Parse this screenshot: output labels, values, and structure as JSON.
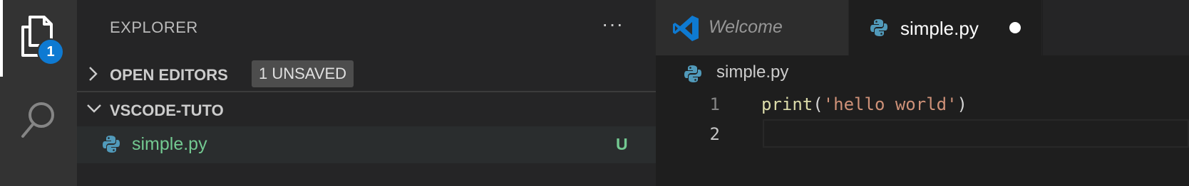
{
  "activity": {
    "explorer_icon": "files-icon",
    "badge_count": "1",
    "search_icon": "search-icon"
  },
  "sidebar": {
    "title": "EXPLORER",
    "more_label": "···",
    "open_editors": {
      "label": "OPEN EDITORS",
      "badge": "1 UNSAVED"
    },
    "folder": {
      "label": "VSCODE-TUTO",
      "files": [
        {
          "name": "simple.py",
          "status": "U",
          "icon": "python-icon"
        }
      ]
    }
  },
  "editor": {
    "tabs": [
      {
        "label": "Welcome",
        "icon": "vscode-icon"
      },
      {
        "label": "simple.py",
        "icon": "python-icon",
        "dirty": true
      }
    ],
    "breadcrumb": "simple.py",
    "line_numbers": [
      "1",
      "2"
    ],
    "code": {
      "fn": "print",
      "open": "(",
      "string": "'hello world'",
      "close": ")"
    }
  },
  "colors": {
    "accent": "#0e7ad2",
    "untracked_green": "#73c991",
    "function_yellow": "#dcdcaa",
    "string_orange": "#ce9178"
  }
}
